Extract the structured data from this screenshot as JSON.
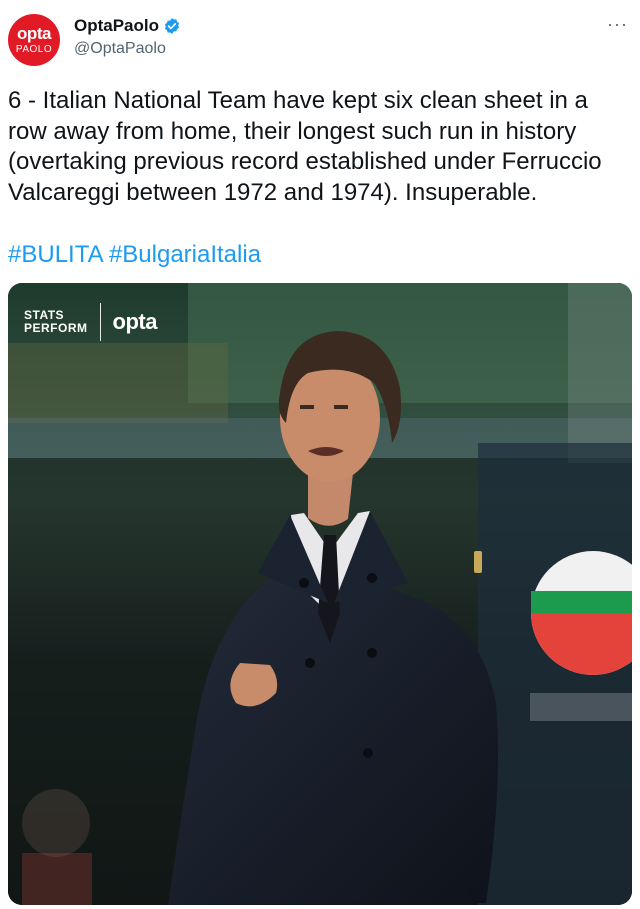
{
  "author": {
    "avatar_top": "opta",
    "avatar_bottom": "PAOLO",
    "display_name": "OptaPaolo",
    "handle": "@OptaPaolo",
    "verified": true
  },
  "menu": {
    "more_label": "···"
  },
  "tweet": {
    "text": "6 - Italian National Team have kept six clean sheet in a row away from home, their longest such run in history (overtaking previous record established under Ferruccio Valcareggi between 1972 and 1974). Insuperable.",
    "hashtags": [
      "#BULITA",
      "#BulgariaItalia"
    ]
  },
  "media": {
    "watermark_stats_line1": "STATS",
    "watermark_stats_line2": "PERFORM",
    "watermark_brand": "opta"
  },
  "colors": {
    "accent": "#1d9bf0",
    "avatar_red": "#e21a26",
    "text": "#0f1419",
    "secondary": "#536471"
  }
}
